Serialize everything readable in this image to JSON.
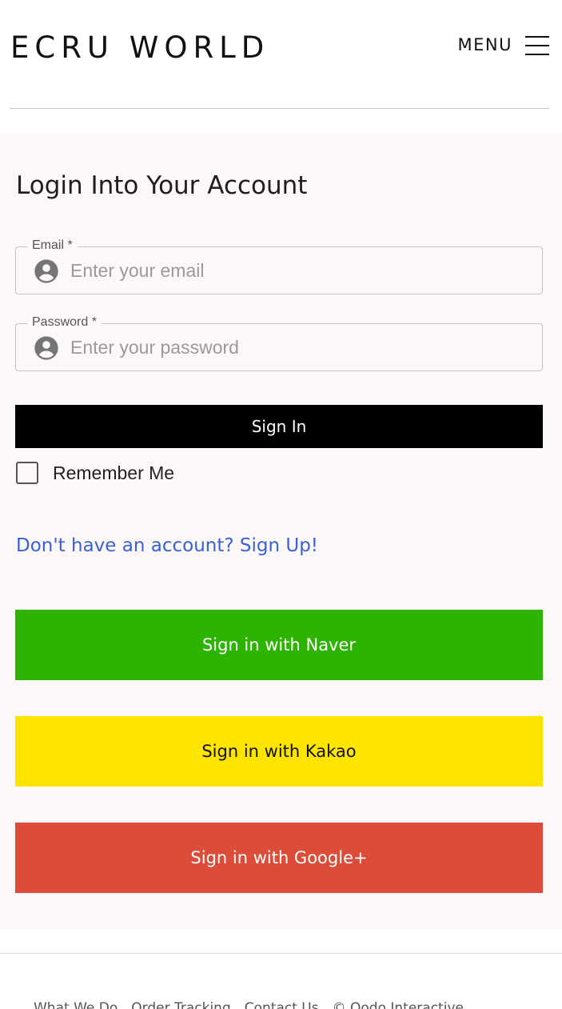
{
  "header": {
    "logo": "ECRU WORLD",
    "menu_label": "MENU"
  },
  "login": {
    "title": "Login Into Your Account",
    "email": {
      "label": "Email *",
      "placeholder": "Enter your email",
      "value": ""
    },
    "password": {
      "label": "Password *",
      "placeholder": "Enter your password",
      "value": ""
    },
    "signin_label": "Sign In",
    "remember_label": "Remember Me",
    "remember_checked": false,
    "signup_link": "Don't have an account? Sign Up!"
  },
  "social": [
    {
      "label": "Sign in with Naver",
      "bg": "#2db400",
      "fg": "#ffffff"
    },
    {
      "label": "Sign in with Kakao",
      "bg": "#fee500",
      "fg": "#111111"
    },
    {
      "label": "Sign in with Google+",
      "bg": "#dd4b39",
      "fg": "#ffffff"
    }
  ],
  "footer": {
    "links": [
      "What We Do",
      "Order Tracking",
      "Contact Us",
      "© Qodo Interactive"
    ]
  },
  "colors": {
    "panel_bg": "#fcf8f7",
    "link": "#3b5fd6",
    "primary_button": "#000000"
  }
}
